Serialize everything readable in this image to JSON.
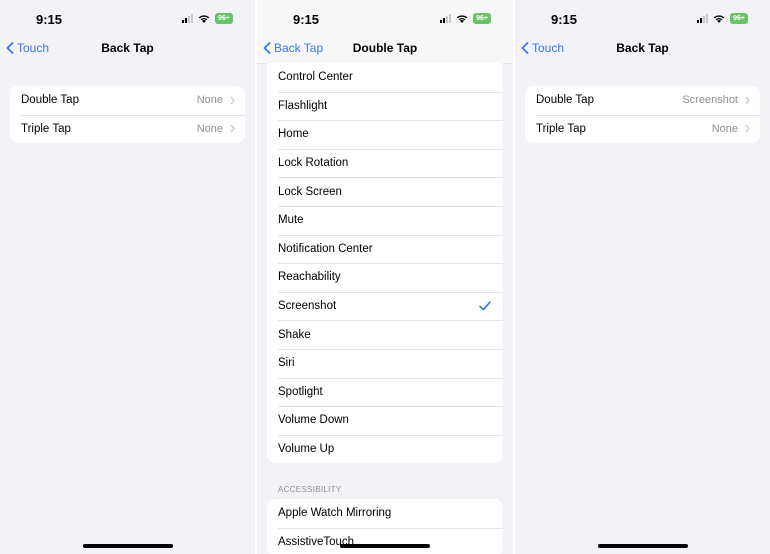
{
  "panels": {
    "left": {
      "status": {
        "time": "9:15",
        "battery": "96+"
      },
      "nav": {
        "back_label": "Touch",
        "title": "Back Tap"
      },
      "rows": [
        {
          "label": "Double Tap",
          "value": "None"
        },
        {
          "label": "Triple Tap",
          "value": "None"
        }
      ]
    },
    "middle": {
      "status": {
        "time": "9:15",
        "battery": "96+"
      },
      "nav": {
        "back_label": "Back Tap",
        "title": "Double Tap"
      },
      "actions": [
        {
          "label": "Control Center",
          "selected": false
        },
        {
          "label": "Flashlight",
          "selected": false
        },
        {
          "label": "Home",
          "selected": false
        },
        {
          "label": "Lock Rotation",
          "selected": false
        },
        {
          "label": "Lock Screen",
          "selected": false
        },
        {
          "label": "Mute",
          "selected": false
        },
        {
          "label": "Notification Center",
          "selected": false
        },
        {
          "label": "Reachability",
          "selected": false
        },
        {
          "label": "Screenshot",
          "selected": true
        },
        {
          "label": "Shake",
          "selected": false
        },
        {
          "label": "Siri",
          "selected": false
        },
        {
          "label": "Spotlight",
          "selected": false
        },
        {
          "label": "Volume Down",
          "selected": false
        },
        {
          "label": "Volume Up",
          "selected": false
        }
      ],
      "accessibility_header": "ACCESSIBILITY",
      "accessibility": [
        {
          "label": "Apple Watch Mirroring"
        },
        {
          "label": "AssistiveTouch"
        }
      ]
    },
    "right": {
      "status": {
        "time": "9:15",
        "battery": "96+"
      },
      "nav": {
        "back_label": "Touch",
        "title": "Back Tap"
      },
      "rows": [
        {
          "label": "Double Tap",
          "value": "Screenshot"
        },
        {
          "label": "Triple Tap",
          "value": "None"
        }
      ]
    }
  },
  "colors": {
    "accent": "#3478f6",
    "background": "#f2f2f7",
    "battery": "#65c466"
  }
}
